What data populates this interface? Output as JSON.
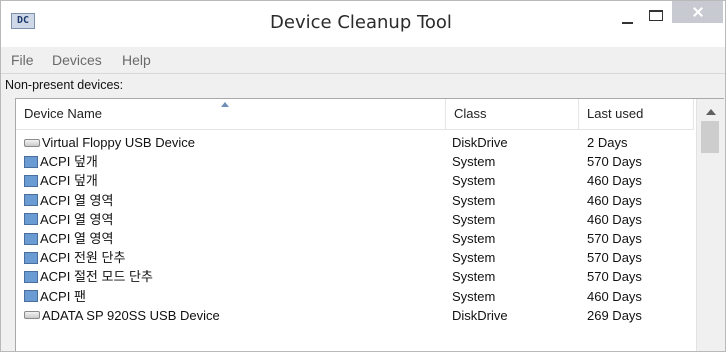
{
  "window": {
    "app_icon_text": "DC",
    "title": "Device Cleanup Tool"
  },
  "menu": [
    "File",
    "Devices",
    "Help"
  ],
  "list_label": "Non-present devices:",
  "columns": [
    "Device Name",
    "Class",
    "Last used"
  ],
  "rows": [
    {
      "icon": "disk-drive-icon",
      "name": "Virtual Floppy USB Device",
      "class": "DiskDrive",
      "last_used": "2 Days"
    },
    {
      "icon": "system-device-icon",
      "name": "ACPI 덮개",
      "class": "System",
      "last_used": "570 Days"
    },
    {
      "icon": "system-device-icon",
      "name": "ACPI 덮개",
      "class": "System",
      "last_used": "460 Days"
    },
    {
      "icon": "system-device-icon",
      "name": "ACPI 열 영역",
      "class": "System",
      "last_used": "460 Days"
    },
    {
      "icon": "system-device-icon",
      "name": "ACPI 열 영역",
      "class": "System",
      "last_used": "460 Days"
    },
    {
      "icon": "system-device-icon",
      "name": "ACPI 열 영역",
      "class": "System",
      "last_used": "570 Days"
    },
    {
      "icon": "system-device-icon",
      "name": "ACPI 전원 단추",
      "class": "System",
      "last_used": "570 Days"
    },
    {
      "icon": "system-device-icon",
      "name": "ACPI 절전 모드 단추",
      "class": "System",
      "last_used": "570 Days"
    },
    {
      "icon": "system-device-icon",
      "name": "ACPI 팬",
      "class": "System",
      "last_used": "460 Days"
    },
    {
      "icon": "disk-drive-icon",
      "name": "ADATA SP 920SS USB Device",
      "class": "DiskDrive",
      "last_used": "269 Days"
    }
  ]
}
